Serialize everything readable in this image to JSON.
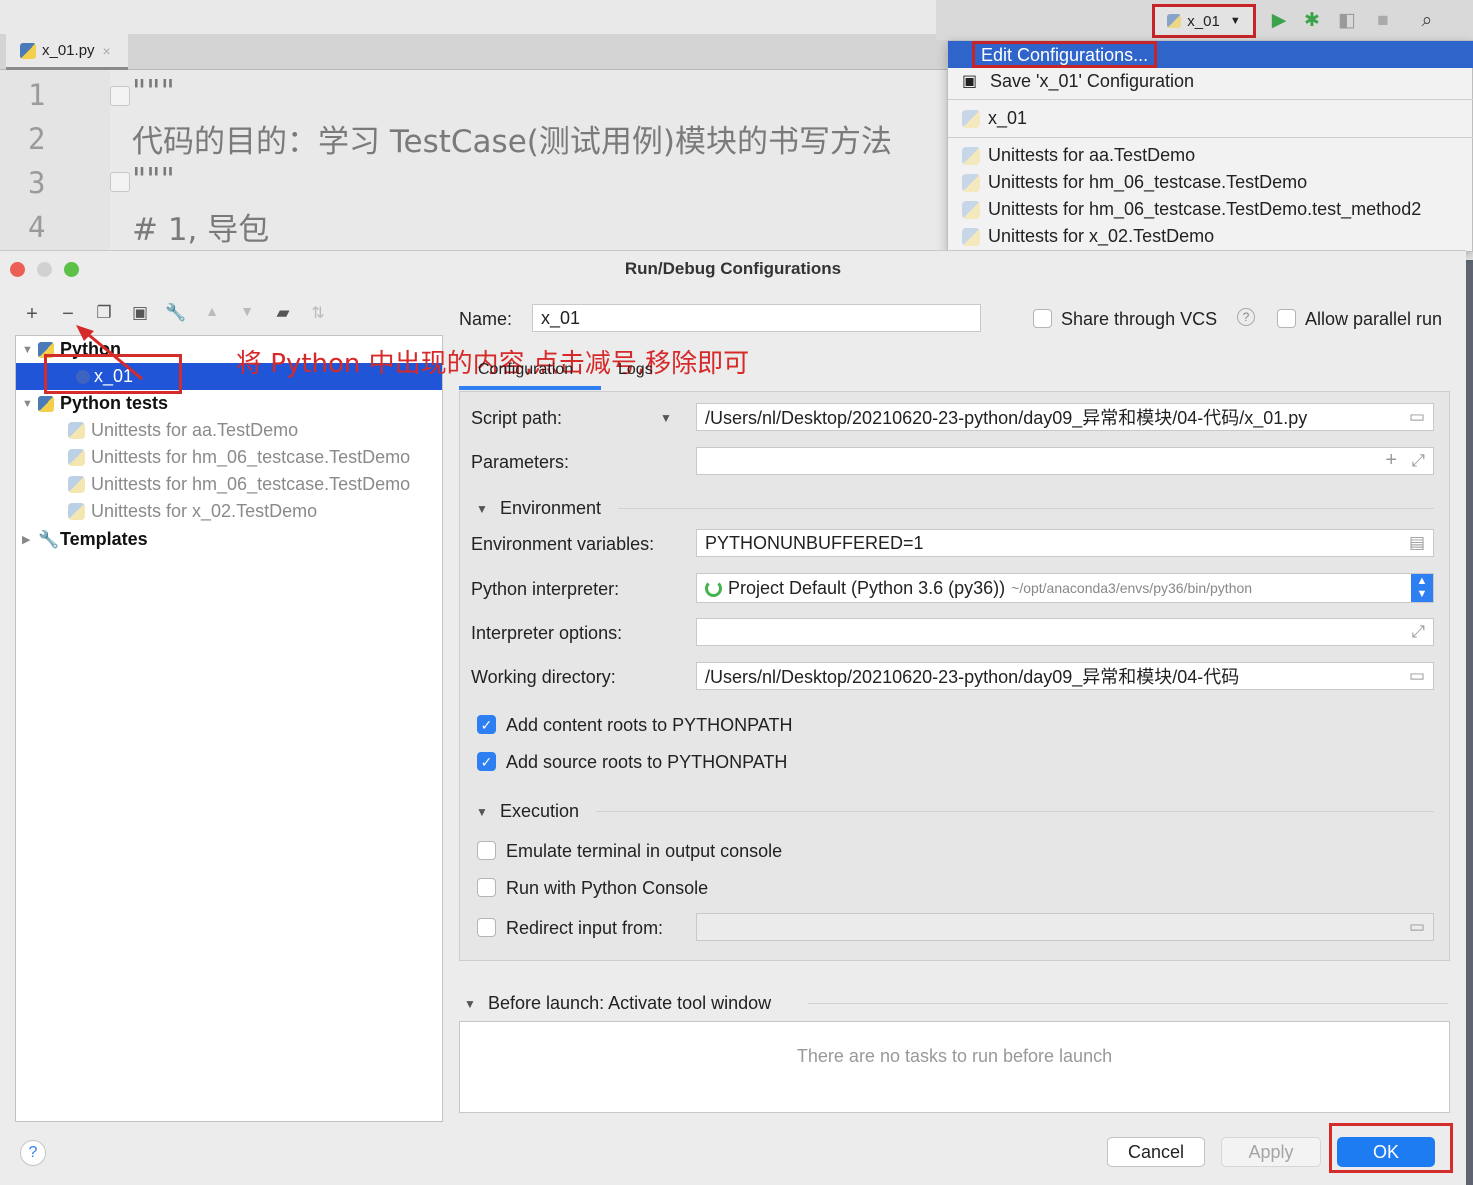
{
  "editor": {
    "tab_label": "x_01.py",
    "tab_close": "×",
    "line_numbers": [
      "1",
      "2",
      "3",
      "4"
    ],
    "lines": [
      "\"\"\"",
      "代码的目的：学习 TestCase(测试用例)模块的书写方法",
      "\"\"\"",
      "# 1, 导包"
    ]
  },
  "toolbar": {
    "run_config": "x_01",
    "dropdown_caret": "▼",
    "icons": [
      "run-icon",
      "debug-icon",
      "coverage-icon",
      "stop-icon",
      "search-icon"
    ]
  },
  "dropdown": {
    "edit_configurations": "Edit Configurations...",
    "save_config": "Save 'x_01' Configuration",
    "current": "x_01",
    "items": [
      "Unittests for aa.TestDemo",
      "Unittests for hm_06_testcase.TestDemo",
      "Unittests for hm_06_testcase.TestDemo.test_method2",
      "Unittests for x_02.TestDemo"
    ]
  },
  "dialog": {
    "title": "Run/Debug Configurations",
    "tree": {
      "python": "Python",
      "x01": "x_01",
      "python_tests": "Python tests",
      "tests": [
        "Unittests for aa.TestDemo",
        "Unittests for hm_06_testcase.TestDemo",
        "Unittests for hm_06_testcase.TestDemo",
        "Unittests for x_02.TestDemo"
      ],
      "templates": "Templates"
    },
    "annotation": "将 Python 中出现的内容,点击减号,移除即可",
    "name_label": "Name:",
    "name_value": "x_01",
    "share_vcs": "Share through VCS",
    "allow_parallel": "Allow parallel run",
    "tabs": [
      "Configuration",
      "Logs"
    ],
    "script_path_label": "Script path:",
    "script_path_value": "/Users/nl/Desktop/20210620-23-python/day09_异常和模块/04-代码/x_01.py",
    "parameters_label": "Parameters:",
    "environment_section": "Environment",
    "env_vars_label": "Environment variables:",
    "env_vars_value": "PYTHONUNBUFFERED=1",
    "interpreter_label": "Python interpreter:",
    "interpreter_value": "Project Default (Python 3.6 (py36))",
    "interpreter_path": "~/opt/anaconda3/envs/py36/bin/python",
    "interp_options_label": "Interpreter options:",
    "working_dir_label": "Working directory:",
    "working_dir_value": "/Users/nl/Desktop/20210620-23-python/day09_异常和模块/04-代码",
    "add_content_roots": "Add content roots to PYTHONPATH",
    "add_source_roots": "Add source roots to PYTHONPATH",
    "execution_section": "Execution",
    "emulate_terminal": "Emulate terminal in output console",
    "run_console": "Run with Python Console",
    "redirect_input": "Redirect input from:",
    "before_launch": "Before launch: Activate tool window",
    "no_tasks": "There are no tasks to run before launch",
    "cancel": "Cancel",
    "apply": "Apply",
    "ok": "OK",
    "help": "?"
  },
  "colors": {
    "accent": "#2f65ca",
    "highlight_red": "#c52528",
    "ok_button": "#1e7cf2"
  }
}
